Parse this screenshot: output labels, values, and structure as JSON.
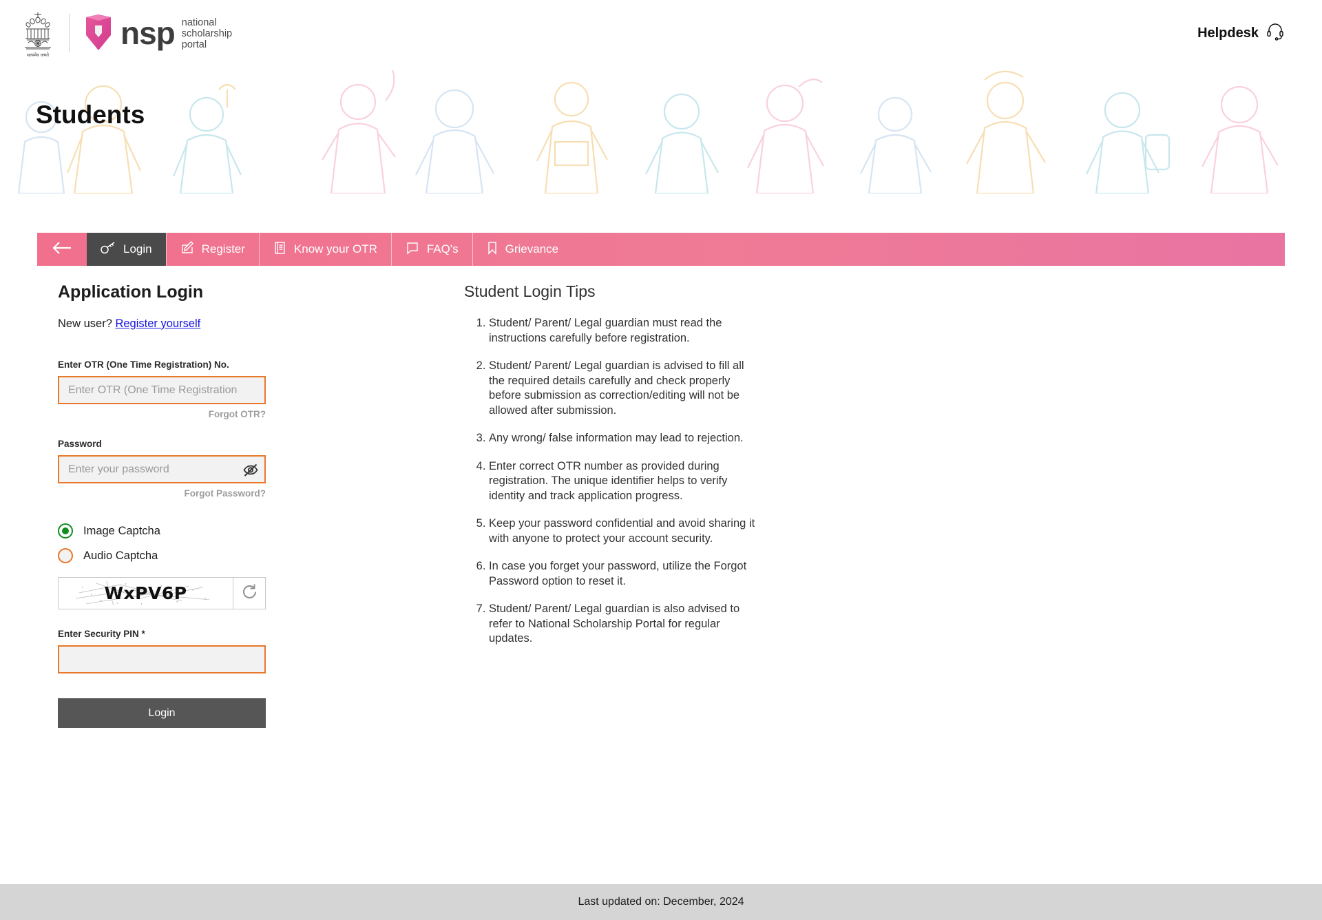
{
  "header": {
    "emblem_caption": "सत्यमेव जयते",
    "logo_word": "nsp",
    "logo_sub_line1": "national",
    "logo_sub_line2": "scholarship",
    "logo_sub_line3": "portal",
    "helpdesk_label": "Helpdesk",
    "helpdesk_icon": "headset-icon"
  },
  "banner": {
    "title": "Students"
  },
  "nav": {
    "back_icon": "arrow-left-icon",
    "items": [
      {
        "label": "Login",
        "icon": "key-icon",
        "active": true
      },
      {
        "label": "Register",
        "icon": "pencil-square-icon",
        "active": false
      },
      {
        "label": "Know your OTR",
        "icon": "document-icon",
        "active": false
      },
      {
        "label": "FAQ's",
        "icon": "chat-bubble-icon",
        "active": false
      },
      {
        "label": "Grievance",
        "icon": "bookmark-icon",
        "active": false
      }
    ]
  },
  "login_form": {
    "title": "Application Login",
    "new_user_text": "New user?",
    "register_link": "Register yourself",
    "otr_label": "Enter OTR (One Time Registration) No.",
    "otr_placeholder": "Enter OTR (One Time Registration) No.",
    "otr_value": "",
    "forgot_otr": "Forgot OTR?",
    "password_label": "Password",
    "password_placeholder": "Enter your password",
    "password_value": "",
    "password_toggle_icon": "eye-slash-icon",
    "forgot_password": "Forgot Password?",
    "captcha_options": [
      {
        "label": "Image Captcha",
        "selected": true
      },
      {
        "label": "Audio Captcha",
        "selected": false
      }
    ],
    "captcha_text": "WxPV6P",
    "captcha_refresh_icon": "refresh-icon",
    "pin_label": "Enter Security PIN *",
    "pin_value": "",
    "login_button": "Login"
  },
  "tips": {
    "title": "Student Login Tips",
    "items": [
      "Student/ Parent/ Legal guardian must read the instructions carefully before registration.",
      "Student/ Parent/ Legal guardian is advised to fill all the required details carefully and check properly before submission as correction/editing will not be allowed after submission.",
      "Any wrong/ false information may lead to rejection.",
      "Enter correct OTR number as provided during registration. The unique identifier helps to verify identity and track application progress.",
      "Keep your password confidential and avoid sharing it with anyone to protect your account security.",
      "In case you forget your password, utilize the Forgot Password option to reset it.",
      "Student/ Parent/ Legal guardian is also advised to refer to National Scholarship Portal for regular updates."
    ]
  },
  "footer": {
    "last_updated": "Last updated on: December, 2024"
  },
  "colors": {
    "nav_pink": "#ef7391",
    "nav_active": "#4a4a4a",
    "input_border_orange": "#e8782a",
    "radio_green": "#128c21",
    "link_blue": "#1414e0",
    "login_button": "#565656",
    "footer_bg": "#d5d5d5"
  }
}
